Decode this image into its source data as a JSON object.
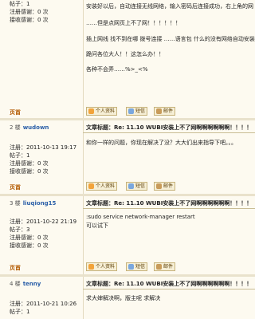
{
  "post0": {
    "stats": [
      "帖子：1",
      "注册感谢：0 次",
      "接收感谢：0 次"
    ],
    "lines": [
      "安装好以后，自动连接无线网络，输入密码后连接成功，右上角的网",
      "……但是点网页上不了网！！！！！！",
      "插上网线 找不到在哪 拨号连接 ……语言包 什么的没有网络自动安装",
      "跪问各位大人！！这怎么办！！",
      "各种不会弄……%>_<%"
    ],
    "page_label": "页首"
  },
  "post1": {
    "floor": "2 楼",
    "user": "wudown",
    "title": "文章标题：Re: 11.10 WUBI安装上不了网啊啊啊啊啊啊！！！！",
    "stats": [
      "注册：2011-10-13 19:17",
      "帖子：1",
      "注册感谢：0 次",
      "接收感谢：0 次"
    ],
    "lines": [
      "和你一样的问题，你现在解决了没？大大们出来指导下吧。。。"
    ],
    "page_label": "页首"
  },
  "post2": {
    "floor": "3 楼",
    "user": "liuqiong15",
    "title": "文章标题：Re: 11.10 WUBI安装上不了网啊啊啊啊啊啊！！！！",
    "stats": [
      "注册：2011-10-22 21:19",
      "帖子：3",
      "注册感谢：0 次",
      "接收感谢：0 次"
    ],
    "lines": [
      ":sudo service network-manager restart",
      "可以试下"
    ],
    "page_label": "页首"
  },
  "post3": {
    "floor": "4 楼",
    "user": "tenny",
    "title": "文章标题：Re: 11.10 WUBI安装上不了网啊啊啊啊啊啊！！！！",
    "stats": [
      "注册：2011-10-21 10:26",
      "帖子：1"
    ],
    "lines": [
      "求大婶解决啊，版主呢 求解决"
    ]
  },
  "buttons": {
    "profile": "个人资料",
    "pm": "短信",
    "email": "邮件"
  },
  "colors": {
    "background": "#fdfaf0",
    "username": "#2b5fa8",
    "page_top": "#b35a00"
  },
  "icons": [
    "person-icon",
    "message-icon",
    "mail-icon"
  ]
}
